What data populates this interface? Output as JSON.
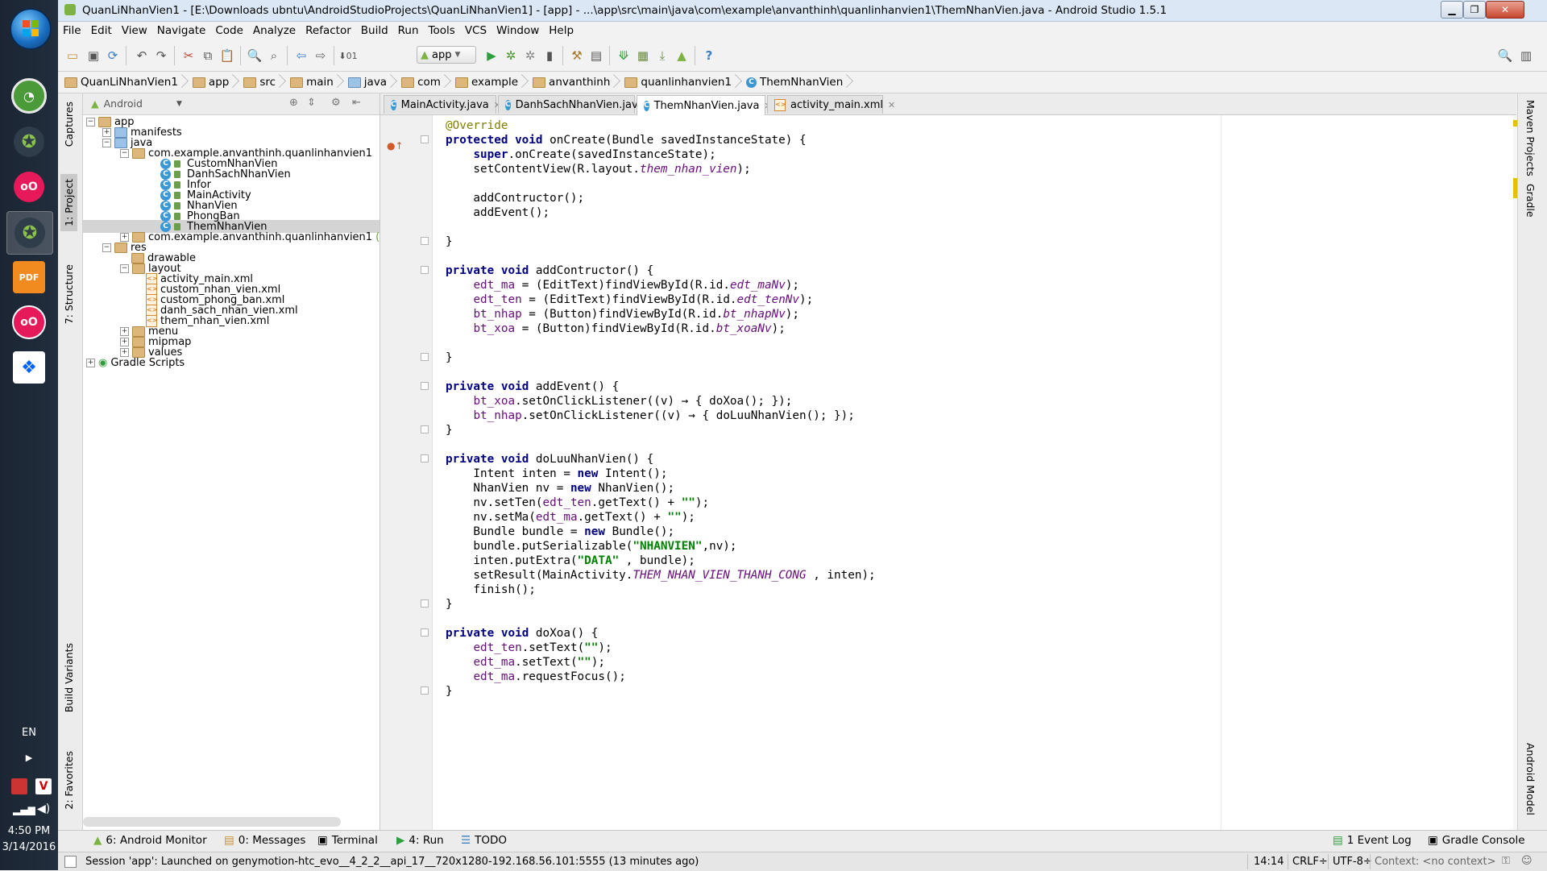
{
  "window": {
    "title": "QuanLiNhanVien1 - [E:\\Downloads ubntu\\AndroidStudioProjects\\QuanLiNhanVien1] - [app] - ...\\app\\src\\main\\java\\com\\example\\anvanthinh\\quanlinhanvien1\\ThemNhanVien.java - Android Studio 1.5.1"
  },
  "menu": [
    "File",
    "Edit",
    "View",
    "Navigate",
    "Code",
    "Analyze",
    "Refactor",
    "Build",
    "Run",
    "Tools",
    "VCS",
    "Window",
    "Help"
  ],
  "toolbar": {
    "run_config": "app"
  },
  "breadcrumb": [
    "QuanLiNhanVien1",
    "app",
    "src",
    "main",
    "java",
    "com",
    "example",
    "anvanthinh",
    "quanlinhanvien1",
    "ThemNhanVien"
  ],
  "left_tools": {
    "captures": "Captures",
    "project": "1: Project",
    "structure": "7: Structure",
    "build_variants": "Build Variants",
    "favorites": "2: Favorites"
  },
  "right_tools": {
    "maven": "Maven Projects",
    "gradle": "Gradle",
    "android_model": "Android Model"
  },
  "project_panel": {
    "view": "Android",
    "tree": [
      {
        "label": "app",
        "depth": 0
      },
      {
        "label": "manifests",
        "depth": 1
      },
      {
        "label": "java",
        "depth": 1
      },
      {
        "label": "com.example.anvanthinh.quanlinhanvien1",
        "depth": 2
      },
      {
        "label": "CustomNhanVien",
        "depth": 3
      },
      {
        "label": "DanhSachNhanVien",
        "depth": 3
      },
      {
        "label": "Infor",
        "depth": 3
      },
      {
        "label": "MainActivity",
        "depth": 3
      },
      {
        "label": "NhanVien",
        "depth": 3
      },
      {
        "label": "PhongBan",
        "depth": 3
      },
      {
        "label": "ThemNhanVien",
        "depth": 3
      },
      {
        "label": "com.example.anvanthinh.quanlinhanvien1",
        "suffix": "(an",
        "depth": 2
      },
      {
        "label": "res",
        "depth": 1
      },
      {
        "label": "drawable",
        "depth": 2
      },
      {
        "label": "layout",
        "depth": 2
      },
      {
        "label": "activity_main.xml",
        "depth": 3
      },
      {
        "label": "custom_nhan_vien.xml",
        "depth": 3
      },
      {
        "label": "custom_phong_ban.xml",
        "depth": 3
      },
      {
        "label": "danh_sach_nhan_vien.xml",
        "depth": 3
      },
      {
        "label": "them_nhan_vien.xml",
        "depth": 3
      },
      {
        "label": "menu",
        "depth": 2
      },
      {
        "label": "mipmap",
        "depth": 2
      },
      {
        "label": "values",
        "depth": 2
      },
      {
        "label": "Gradle Scripts",
        "depth": 0
      }
    ]
  },
  "editor_tabs": [
    {
      "label": "MainActivity.java",
      "active": false
    },
    {
      "label": "DanhSachNhanVien.java",
      "active": false
    },
    {
      "label": "ThemNhanVien.java",
      "active": true
    },
    {
      "label": "activity_main.xml",
      "active": false
    }
  ],
  "code_lines": [
    "@Override",
    "protected void onCreate(Bundle savedInstanceState) {",
    "    super.onCreate(savedInstanceState);",
    "    setContentView(R.layout.them_nhan_vien);",
    "",
    "    addContructor();",
    "    addEvent();",
    "",
    "}",
    "",
    "private void addContructor() {",
    "    edt_ma = (EditText)findViewById(R.id.edt_maNv);",
    "    edt_ten = (EditText)findViewById(R.id.edt_tenNv);",
    "    bt_nhap = (Button)findViewById(R.id.bt_nhapNv);",
    "    bt_xoa = (Button)findViewById(R.id.bt_xoaNv);",
    "",
    "}",
    "",
    "private void addEvent() {",
    "    bt_xoa.setOnClickListener((v) → { doXoa(); });",
    "    bt_nhap.setOnClickListener((v) → { doLuuNhanVien(); });",
    "}",
    "",
    "private void doLuuNhanVien() {",
    "    Intent inten = new Intent();",
    "    NhanVien nv = new NhanVien();",
    "    nv.setTen(edt_ten.getText() + \"\");",
    "    nv.setMa(edt_ma.getText() + \"\");",
    "    Bundle bundle = new Bundle();",
    "    bundle.putSerializable(\"NHANVIEN\",nv);",
    "    inten.putExtra(\"DATA\" , bundle);",
    "    setResult(MainActivity.THEM_NHAN_VIEN_THANH_CONG , inten);",
    "    finish();",
    "}",
    "",
    "private void doXoa() {",
    "    edt_ten.setText(\"\");",
    "    edt_ma.setText(\"\");",
    "    edt_ma.requestFocus();",
    "}"
  ],
  "bottom_tools": [
    {
      "label": "6: Android Monitor"
    },
    {
      "label": "0: Messages"
    },
    {
      "label": "Terminal"
    },
    {
      "label": "4: Run"
    },
    {
      "label": "TODO"
    },
    {
      "label": "1 Event Log"
    },
    {
      "label": "Gradle Console"
    }
  ],
  "status": {
    "message": "Session 'app': Launched on genymotion-htc_evo__4_2_2__api_17__720x1280-192.168.56.101:5555 (13 minutes ago)",
    "position": "14:14",
    "line_sep": "CRLF÷",
    "encoding": "UTF-8÷",
    "context": "Context: <no context>"
  },
  "taskbar": {
    "lang": "EN",
    "time": "4:50 PM",
    "date": "3/14/2016"
  },
  "colors": {
    "keyword": "#000080",
    "field": "#660e7a",
    "string": "#008000",
    "annotation": "#808000",
    "win_blue": "#1a6fc2"
  }
}
